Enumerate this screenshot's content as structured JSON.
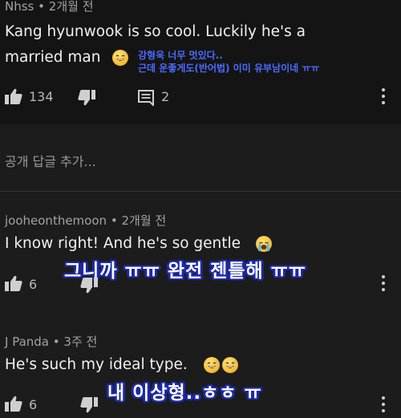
{
  "comments": [
    {
      "author": "Nhss",
      "time": "2개월 전",
      "text_line1": "Kang hyunwook is so cool. Luckily he's a",
      "text_line2": "married man",
      "subtitle_line1": "강형욱 너무 멋있다..",
      "subtitle_line2": "근데 운좋게도(반어법) 이미 유부남이네 ㅠㅠ",
      "likes": "134",
      "replies": "2",
      "emoji": "grinning-sweat-face"
    },
    {
      "author": "jooheonthemoon",
      "time": "2개월 전",
      "text": "I know right! And he's so gentle",
      "subtitle": "그니까 ㅠㅠ 완전 젠틀해 ㅠㅠ",
      "likes": "6",
      "emoji": "loudly-crying-face"
    },
    {
      "author": "J Panda",
      "time": "3주 전",
      "text": "He's such my ideal type.",
      "subtitle": "내 이상형..ㅎㅎ ㅠ",
      "likes": "6",
      "emoji": "grinning-sweat-face"
    }
  ],
  "add_reply_placeholder": "공개 답글 추가...",
  "meta_separator": "•",
  "colors": {
    "background": "#1c1c1c",
    "top_background": "#141414",
    "subtitle_outline": "#1d2aa8",
    "small_subtitle": "#4a6bff"
  }
}
